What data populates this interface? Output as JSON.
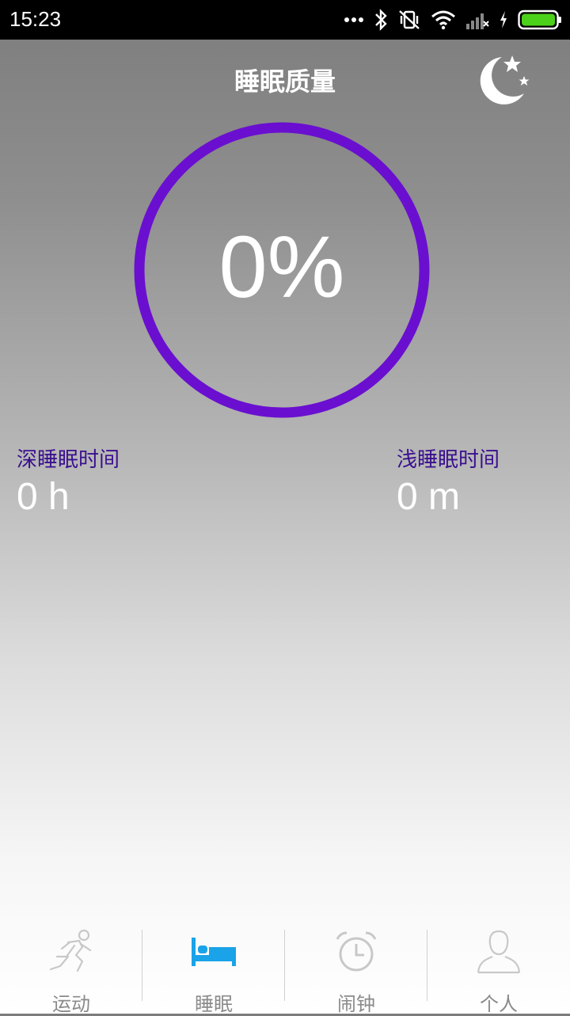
{
  "status_bar": {
    "time": "15:23",
    "icons": [
      "more-dots-icon",
      "bluetooth-icon",
      "vibrate-off-icon",
      "wifi-icon",
      "signal-icon",
      "charging-icon",
      "battery-icon"
    ],
    "battery_color": "#4cd11a"
  },
  "header": {
    "title": "睡眠质量",
    "right_icon": "moon-stars-icon"
  },
  "quality": {
    "value_text": "0%",
    "percent": 0,
    "ring_color": "#6a0fd0"
  },
  "stats": {
    "deep": {
      "label": "深睡眠时间",
      "value": "0 h"
    },
    "light": {
      "label": "浅睡眠时间",
      "value": "0 m"
    },
    "label_color": "#3a0f8f"
  },
  "nav": {
    "items": [
      {
        "label": "运动",
        "icon": "running-icon",
        "active": false
      },
      {
        "label": "睡眠",
        "icon": "bed-icon",
        "active": true
      },
      {
        "label": "闹钟",
        "icon": "alarm-clock-icon",
        "active": false
      },
      {
        "label": "个人",
        "icon": "person-icon",
        "active": false
      }
    ],
    "active_color": "#1aa3e8",
    "inactive_color": "#c8c8c8"
  }
}
